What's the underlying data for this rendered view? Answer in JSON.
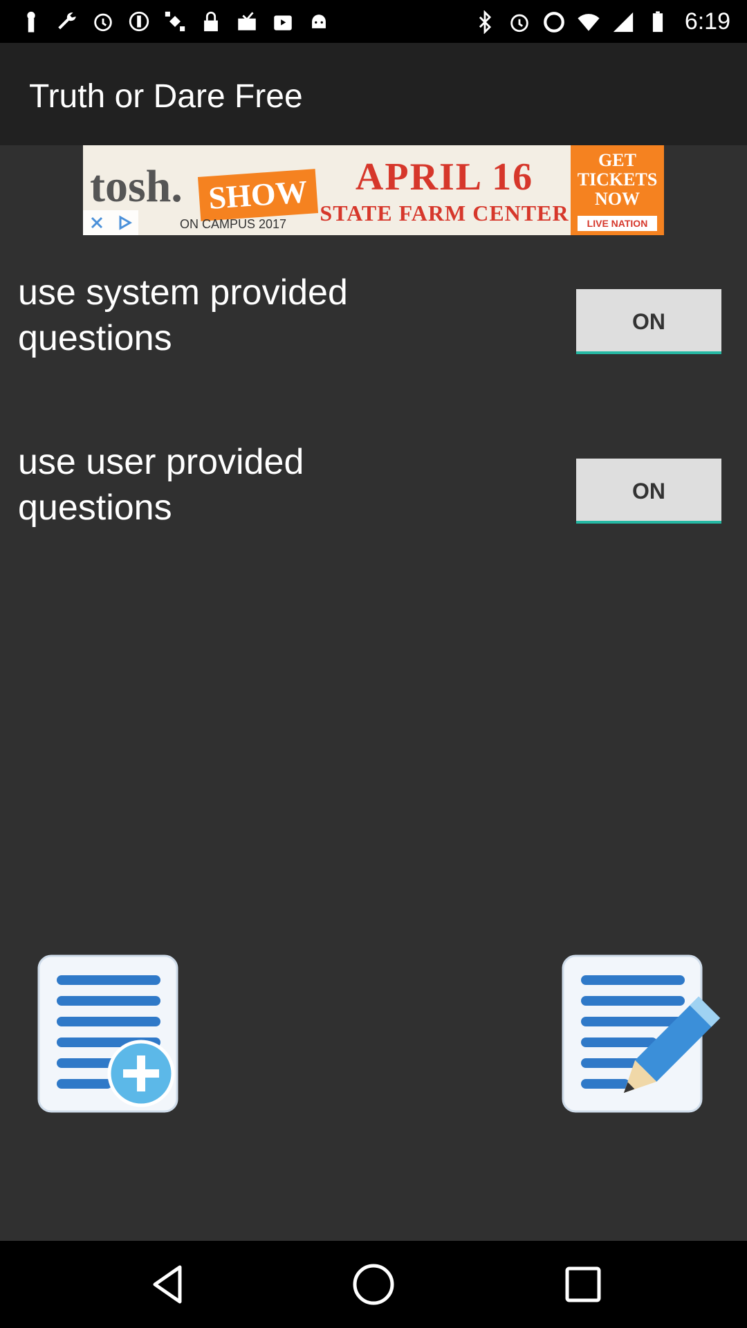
{
  "status_bar": {
    "time": "6:19"
  },
  "app_bar": {
    "title": "Truth or Dare Free"
  },
  "ad": {
    "brand": "tosh.",
    "brand_accent": "SHOW",
    "subtext": "ON CAMPUS 2017",
    "date": "APRIL 16",
    "venue": "STATE FARM CENTER",
    "cta": "GET TICKETS NOW",
    "badge": "LIVE NATION"
  },
  "settings": [
    {
      "label": "use system provided questions",
      "toggle": "ON"
    },
    {
      "label": "use user provided questions",
      "toggle": "ON"
    }
  ],
  "colors": {
    "background": "#303030",
    "app_bar": "#212121",
    "toggle_bg": "#dedede",
    "toggle_accent": "#26b8a3"
  },
  "icons": {
    "add_list": "add-question-list-icon",
    "edit_list": "edit-question-list-icon"
  }
}
